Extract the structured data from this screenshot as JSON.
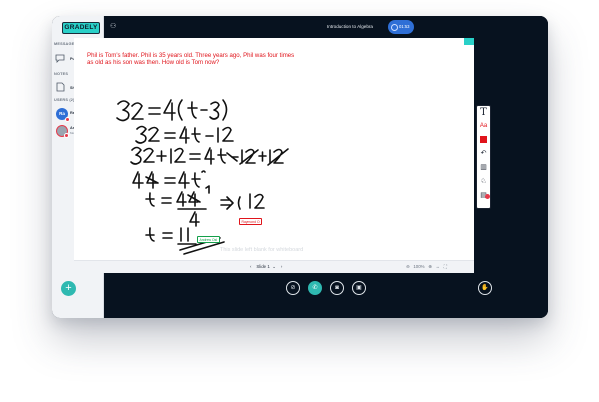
{
  "app": {
    "logo_text": "GRADELY"
  },
  "sidebar": {
    "messages_label": "MESSAGES",
    "public_chat_label": "Public Chat",
    "notes_label": "NOTES",
    "shared_notes_label": "Shared Notes",
    "users_label": "USERS (2)",
    "users": [
      {
        "initials": "Ra",
        "name": "Raymond... (You)",
        "subtitle": ""
      },
      {
        "initials": "",
        "name": "Andrew Oshio...",
        "subtitle": "Mobile"
      }
    ]
  },
  "header": {
    "title": "Introduction to Algebra",
    "timer": "01:53"
  },
  "slide": {
    "question": "Phil is Tom's father. Phil is 35 years old. Three years ago, Phil was four times as old as his son was then. How old is Tom now?",
    "blank_hint": "This slide left blank for whiteboard",
    "cursor_red": "Raymond O",
    "cursor_green": "Andrew Osl",
    "nav_label": "Slide 1",
    "zoom_label": "100%"
  },
  "colors": {
    "accent": "#2fb9b1",
    "question_red": "#e0141b",
    "timer_blue": "#2f6fd6",
    "bar_dark": "#07121f"
  }
}
